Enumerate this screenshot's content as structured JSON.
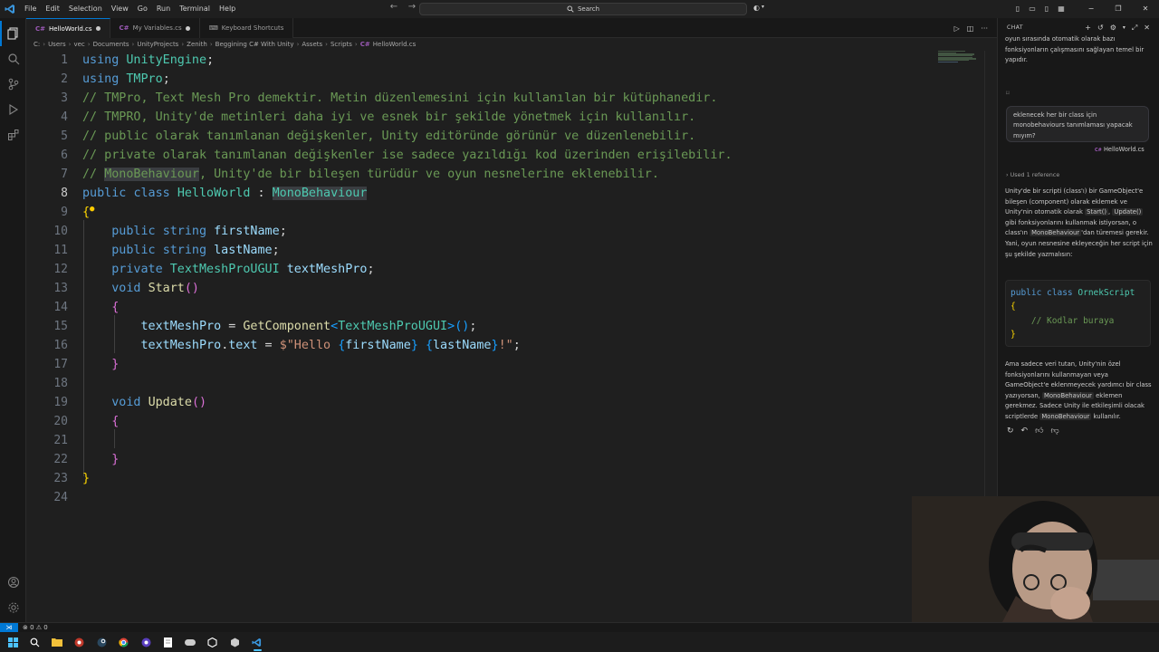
{
  "menu": [
    "File",
    "Edit",
    "Selection",
    "View",
    "Go",
    "Run",
    "Terminal",
    "Help"
  ],
  "search": {
    "label": "Search"
  },
  "tabs": [
    {
      "label": "HelloWorld.cs",
      "modified": true,
      "active": true
    },
    {
      "label": "My Variables.cs",
      "modified": true,
      "active": false
    },
    {
      "label": "Keyboard Shortcuts",
      "modified": false,
      "active": false
    }
  ],
  "breadcrumb": [
    "C:",
    "Users",
    "vec",
    "Documents",
    "UnityProjects",
    "Zenith",
    "Beggining C# With Unity",
    "Assets",
    "Scripts",
    "HelloWorld.cs"
  ],
  "editor": {
    "line_numbers": [
      "1",
      "2",
      "3",
      "4",
      "5",
      "6",
      "7",
      "8",
      "9",
      "10",
      "11",
      "12",
      "13",
      "14",
      "15",
      "16",
      "17",
      "18",
      "19",
      "20",
      "21",
      "22",
      "23",
      "24"
    ],
    "current_line": "8",
    "lines": {
      "l1": {
        "kw": "using",
        "ns": "UnityEngine",
        "end": ";"
      },
      "l2": {
        "kw": "using",
        "ns": "TMPro",
        "end": ";"
      },
      "l3": "// TMPro, Text Mesh Pro demektir. Metin düzenlemesini için kullanılan bir kütüphanedir.",
      "l4": "// TMPRO, Unity'de metinleri daha iyi ve esnek bir şekilde yönetmek için kullanılır.",
      "l5": "// public olarak tanımlanan değişkenler, Unity editöründe görünür ve düzenlenebilir.",
      "l6": "// private olarak tanımlanan değişkenler ise sadece yazıldığı kod üzerinden erişilebilir.",
      "l7_prefix": "// ",
      "l7_hl": "MonoBehaviour",
      "l7_rest": ", Unity'de bir bileşen türüdür ve oyun nesnelerine eklenebilir.",
      "l8": {
        "kw1": "public",
        "kw2": "class",
        "name": "HelloWorld",
        "colon": " : ",
        "base": "MonoBehaviour"
      },
      "l9": "{",
      "l10": {
        "kw1": "public",
        "kw2": "string",
        "name": "firstName",
        "end": ";"
      },
      "l11": {
        "kw1": "public",
        "kw2": "string",
        "name": "lastName",
        "end": ";"
      },
      "l12": {
        "kw1": "private",
        "type": "TextMeshProUGUI",
        "name": "textMeshPro",
        "end": ";"
      },
      "l13": {
        "kw": "void",
        "fn": "Start",
        "parens": "()"
      },
      "l14": "{",
      "l15": {
        "var": "textMeshPro",
        "eq": " = ",
        "fn": "GetComponent",
        "lt": "<",
        "type": "TextMeshProUGUI",
        "gt": ">",
        "call": "()",
        "end": ";"
      },
      "l16": {
        "var": "textMeshPro",
        "dot": ".",
        "prop": "text",
        "eq": " = ",
        "s1": "$\"Hello ",
        "ob1": "{",
        "v1": "firstName",
        "cb1": "}",
        "sp": " ",
        "ob2": "{",
        "v2": "lastName",
        "cb2": "}",
        "s2": "!\"",
        "end": ";"
      },
      "l17": "}",
      "l19": {
        "kw": "void",
        "fn": "Update",
        "parens": "()"
      },
      "l20": "{",
      "l22": "}",
      "l23": "}"
    }
  },
  "chat": {
    "header": "CHAT",
    "intro": "oyun sırasında otomatik olarak bazı fonksiyonların çalışmasını sağlayan temel bir yapıdır.",
    "user_message": "eklenecek her bir class için monobehaviours tanımlaması yapacak mıyım?",
    "reference_file": "HelloWorld.cs",
    "used_reference": "Used 1 reference",
    "answer_1a": "Unity'de bir scripti (class'ı) bir GameObject'e bileşen (component) olarak eklemek ve Unity'nin otomatik olarak",
    "answer_start": "Start()",
    "answer_1b": ",",
    "answer_update": "Update()",
    "answer_1c": "gibi fonksiyonlarını kullanmak istiyorsan, o class'ın",
    "answer_mono": "MonoBehaviour",
    "answer_1d": "'dan türemesi gerekir. Yani, oyun nesnesine ekleyeceğin her script için şu şekilde yazmalısın:",
    "code_line1_kw": "public class",
    "code_line1_name": "OrnekScript",
    "code_line2": "{",
    "code_line3": "// Kodlar buraya",
    "code_line4": "}",
    "answer_2a": "Ama sadece veri tutan, Unity'nin özel fonksiyonlarını kullanmayan veya GameObject'e eklenmeyecek yardımcı bir class yazıyorsan,",
    "answer_2_mono": "MonoBehaviour",
    "answer_2b": "eklemen gerekmez. Sadece Unity ile etkileşimli olacak scriptlerde",
    "answer_2_mono2": "MonoBehaviour",
    "answer_2c": "kullanılır."
  },
  "status": {
    "remote": "⋊",
    "errors": "⊗ 0  ⚠ 0"
  },
  "colors": {
    "accent": "#0078d4",
    "keyword": "#569cd6",
    "type": "#4ec9b0",
    "comment": "#6a9955",
    "variable": "#9cdcfe",
    "function": "#dcdcaa",
    "string": "#ce9178"
  }
}
